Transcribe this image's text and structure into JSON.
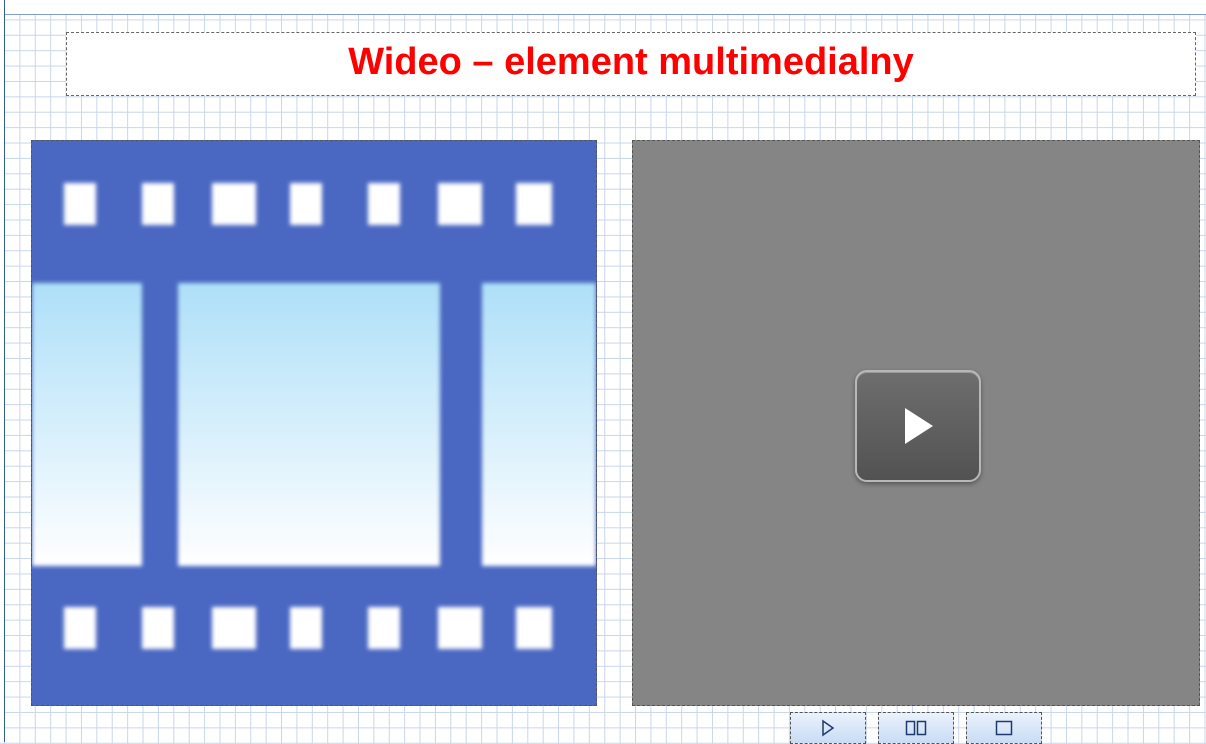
{
  "title": "Wideo – element multimedialny",
  "colors": {
    "title": "#ff0000",
    "film_strip": "#4a67c2",
    "film_frame_top": "#aedff8",
    "film_frame_bottom": "#ffffff",
    "video_background": "#858585",
    "grid_lines": "#c9d6ea"
  },
  "film_icon": {
    "name": "film-strip-icon"
  },
  "video_player": {
    "play_overlay_icon": "play-icon"
  },
  "controls": [
    {
      "name": "play-control-button",
      "icon": "play-outline-icon"
    },
    {
      "name": "pause-control-button",
      "icon": "pause-outline-icon"
    },
    {
      "name": "stop-control-button",
      "icon": "stop-outline-icon"
    }
  ]
}
